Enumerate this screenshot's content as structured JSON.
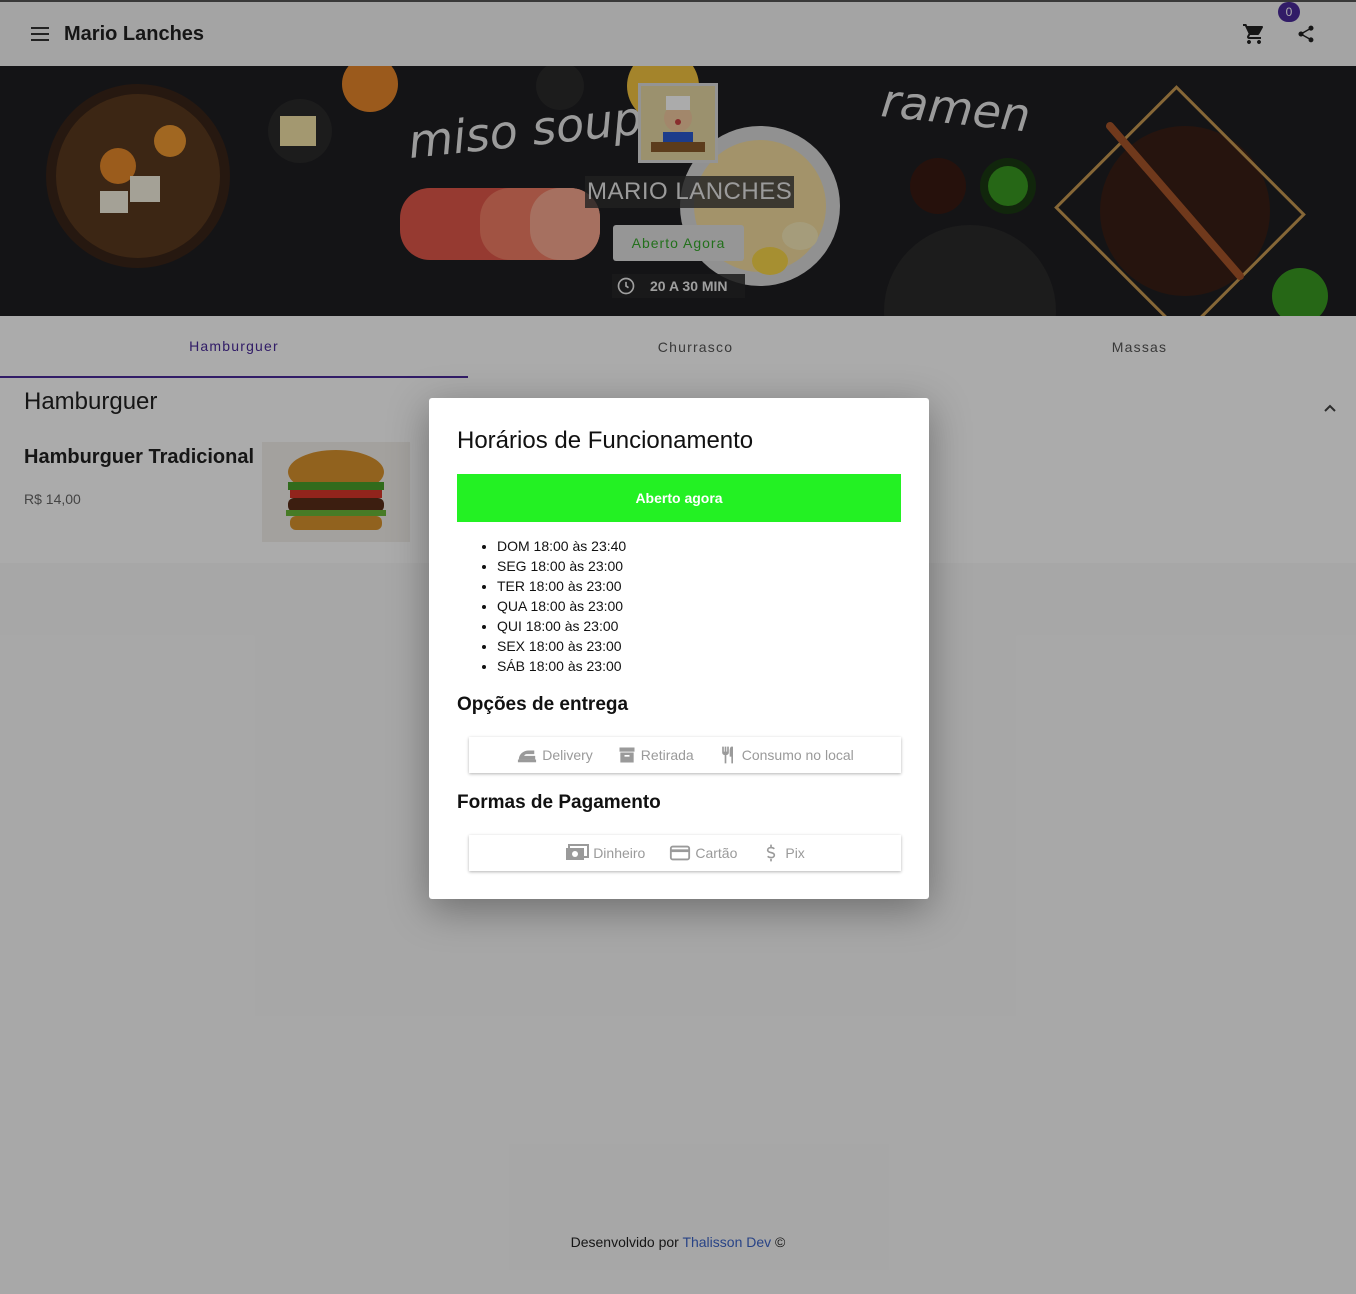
{
  "appbar": {
    "title": "Mario Lanches",
    "cart_count": "0"
  },
  "banner": {
    "store_name": "MARIO LANCHES",
    "status_button": "Aberto Agora",
    "delivery_time": "20 A 30 MIN",
    "decor_text_1": "miso soup",
    "decor_text_2": "ramen"
  },
  "tabs": [
    {
      "label": "Hamburguer"
    },
    {
      "label": "Churrasco"
    },
    {
      "label": "Massas"
    }
  ],
  "section": {
    "title": "Hamburguer",
    "product_name": "Hamburguer Tradicional",
    "product_price": "R$ 14,00"
  },
  "footer": {
    "prefix": "Desenvolvido por",
    "author": "Thalisson Dev",
    "suffix": "©"
  },
  "dialog": {
    "title": "Horários de Funcionamento",
    "status": "Aberto agora",
    "hours": [
      "DOM 18:00 às 23:40",
      "SEG 18:00 às 23:00",
      "TER 18:00 às 23:00",
      "QUA 18:00 às 23:00",
      "QUI 18:00 às 23:00",
      "SEX 18:00 às 23:00",
      "SÁB 18:00 às 23:00"
    ],
    "delivery_title": "Opções de entrega",
    "delivery_options": [
      "Delivery",
      "Retirada",
      "Consumo no local"
    ],
    "payment_title": "Formas de Pagamento",
    "payment_options": [
      "Dinheiro",
      "Cartão",
      "Pix"
    ]
  },
  "colors": {
    "accent": "#4a2b9a",
    "open_green": "#23f123",
    "status_text_green": "#35a82a",
    "link_blue": "#3c64c8"
  }
}
